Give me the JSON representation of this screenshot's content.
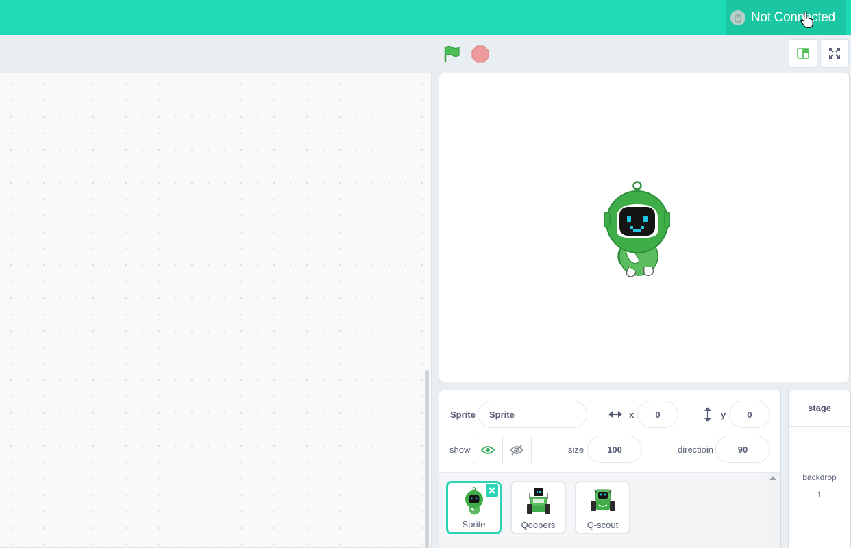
{
  "header": {
    "connection_status": "Not Connected",
    "connection_icon": "device-icon"
  },
  "controls": {
    "green_flag_icon": "green-flag-icon",
    "stop_icon": "stop-icon",
    "small_stage_icon": "small-stage-mode-icon",
    "fullscreen_icon": "fullscreen-icon"
  },
  "sprite_info": {
    "sprite_label": "Sprite",
    "sprite_name": "Sprite",
    "x_label": "x",
    "x_value": "0",
    "y_label": "y",
    "y_value": "0",
    "show_label": "show",
    "size_label": "size",
    "size_value": "100",
    "direction_label": "directioin",
    "direction_value": "90"
  },
  "sprites": [
    {
      "name": "Sprite",
      "selected": true
    },
    {
      "name": "Qoopers",
      "selected": false
    },
    {
      "name": "Q-scout",
      "selected": false
    }
  ],
  "stage_panel": {
    "title": "stage",
    "backdrop_label": "backdrop",
    "backdrop_count": "1"
  },
  "colors": {
    "header": "#1fdbb5",
    "accent": "#2bd3b5",
    "flag": "#4cbf56",
    "stop": "#ec9a9a"
  }
}
